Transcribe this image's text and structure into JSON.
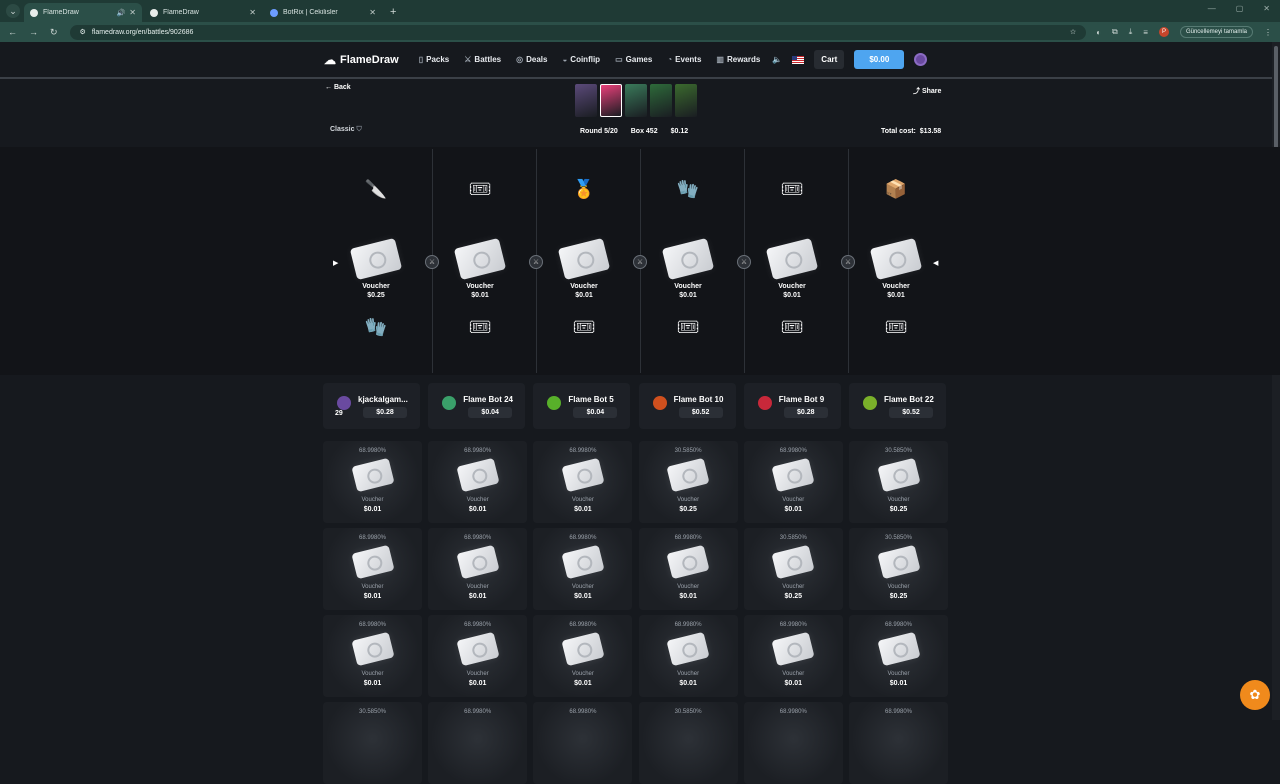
{
  "browser": {
    "tabs": [
      {
        "title": "FlameDraw",
        "active": true,
        "audio": true
      },
      {
        "title": "FlameDraw",
        "active": false,
        "audio": false
      },
      {
        "title": "BotRix | Cekilisler",
        "active": false,
        "audio": false
      }
    ],
    "url": "flamedraw.org/en/battles/902686",
    "update_label": "Güncellemeyi tamamla",
    "profile_initial": "P"
  },
  "header": {
    "logo": "FlameDraw",
    "menu": [
      "Packs",
      "Battles",
      "Deals",
      "Coinflip",
      "Games",
      "Events",
      "Rewards"
    ],
    "cart": "Cart",
    "balance": "$0.00"
  },
  "battle": {
    "back": "Back",
    "share": "Share",
    "mode": "Classic",
    "round": "Round 5/20",
    "box": "Box 452",
    "box_price": "$0.12",
    "total_label": "Total cost:",
    "total": "$13.58",
    "box_colors": [
      "#5b4a7a",
      "#e8407a",
      "#3a7a5a",
      "#2e6a3a",
      "#3b6a2e"
    ]
  },
  "spinner": {
    "top_icons": [
      "🔪",
      "🎟",
      "🏅",
      "🧤",
      "🎟",
      "📦"
    ],
    "slots": [
      {
        "name": "Voucher",
        "price": "$0.25"
      },
      {
        "name": "Voucher",
        "price": "$0.01"
      },
      {
        "name": "Voucher",
        "price": "$0.01"
      },
      {
        "name": "Voucher",
        "price": "$0.01"
      },
      {
        "name": "Voucher",
        "price": "$0.01"
      },
      {
        "name": "Voucher",
        "price": "$0.01"
      }
    ],
    "bottom_icons": [
      "🧤",
      "🎟",
      "🎟",
      "🎟",
      "🎟",
      "🎟"
    ]
  },
  "players": [
    {
      "name": "kjackalgam...",
      "value": "$0.28",
      "level": "29",
      "avatar_color": "#6a4aa0"
    },
    {
      "name": "Flame Bot 24",
      "value": "$0.04",
      "avatar_color": "#3aa06a"
    },
    {
      "name": "Flame Bot 5",
      "value": "$0.04",
      "avatar_color": "#58b02a"
    },
    {
      "name": "Flame Bot 10",
      "value": "$0.52",
      "avatar_color": "#d0501e"
    },
    {
      "name": "Flame Bot 9",
      "value": "$0.28",
      "avatar_color": "#c8283a"
    },
    {
      "name": "Flame Bot 22",
      "value": "$0.52",
      "avatar_color": "#7ab02a"
    }
  ],
  "rounds": [
    [
      {
        "odds": "68.9980%",
        "name": "Voucher",
        "price": "$0.01"
      },
      {
        "odds": "68.9980%",
        "name": "Voucher",
        "price": "$0.01"
      },
      {
        "odds": "68.9980%",
        "name": "Voucher",
        "price": "$0.01"
      },
      {
        "odds": "30.5850%",
        "name": "Voucher",
        "price": "$0.25"
      },
      {
        "odds": "68.9980%",
        "name": "Voucher",
        "price": "$0.01"
      },
      {
        "odds": "30.5850%",
        "name": "Voucher",
        "price": "$0.25"
      }
    ],
    [
      {
        "odds": "68.9980%",
        "name": "Voucher",
        "price": "$0.01"
      },
      {
        "odds": "68.9980%",
        "name": "Voucher",
        "price": "$0.01"
      },
      {
        "odds": "68.9980%",
        "name": "Voucher",
        "price": "$0.01"
      },
      {
        "odds": "68.9980%",
        "name": "Voucher",
        "price": "$0.01"
      },
      {
        "odds": "30.5850%",
        "name": "Voucher",
        "price": "$0.25"
      },
      {
        "odds": "30.5850%",
        "name": "Voucher",
        "price": "$0.25"
      }
    ],
    [
      {
        "odds": "68.9980%",
        "name": "Voucher",
        "price": "$0.01"
      },
      {
        "odds": "68.9980%",
        "name": "Voucher",
        "price": "$0.01"
      },
      {
        "odds": "68.9980%",
        "name": "Voucher",
        "price": "$0.01"
      },
      {
        "odds": "68.9980%",
        "name": "Voucher",
        "price": "$0.01"
      },
      {
        "odds": "68.9980%",
        "name": "Voucher",
        "price": "$0.01"
      },
      {
        "odds": "68.9980%",
        "name": "Voucher",
        "price": "$0.01"
      }
    ],
    [
      {
        "odds": "30.5850%"
      },
      {
        "odds": "68.9980%"
      },
      {
        "odds": "68.9980%"
      },
      {
        "odds": "30.5850%"
      },
      {
        "odds": "68.9980%"
      },
      {
        "odds": "68.9980%"
      }
    ]
  ]
}
